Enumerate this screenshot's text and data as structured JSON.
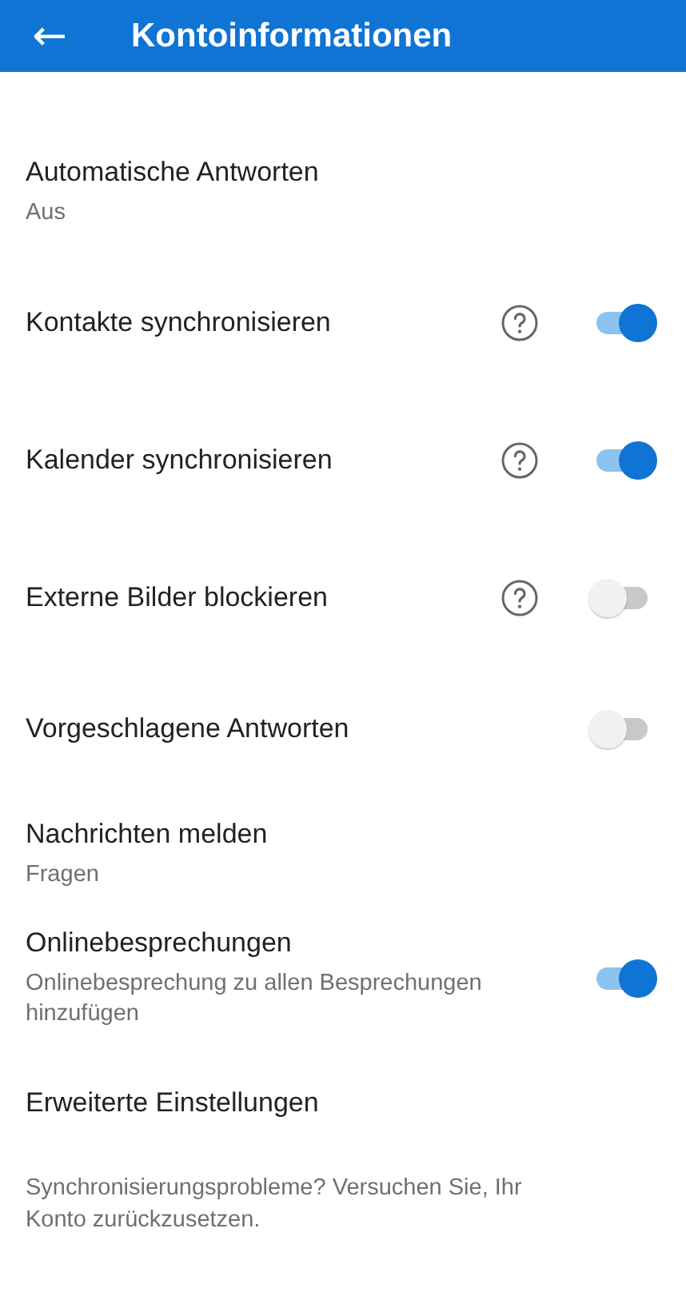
{
  "header": {
    "back": "←",
    "title": "Kontoinformationen"
  },
  "items": [
    {
      "kind": "nav",
      "label": "Automatische Antworten",
      "subtitle": "Aus"
    },
    {
      "kind": "toggle",
      "label": "Kontakte synchronisieren",
      "help": true,
      "on": true
    },
    {
      "kind": "toggle",
      "label": "Kalender synchronisieren",
      "help": true,
      "on": true
    },
    {
      "kind": "toggle",
      "label": "Externe Bilder blockieren",
      "help": true,
      "on": false
    },
    {
      "kind": "toggle",
      "label": "Vorgeschlagene Antworten",
      "help": false,
      "on": false
    },
    {
      "kind": "nav",
      "label": "Nachrichten melden",
      "subtitle": "Fragen"
    },
    {
      "kind": "toggle",
      "label": "Onlinebesprechungen",
      "subtitle": "Onlinebesprechung zu allen Besprechungen hinzufügen",
      "help": false,
      "on": true
    },
    {
      "kind": "nav",
      "label": "Erweiterte Einstellungen"
    }
  ],
  "footer": "Synchronisierungsprobleme? Versuchen Sie, Ihr Konto zurückzusetzen."
}
